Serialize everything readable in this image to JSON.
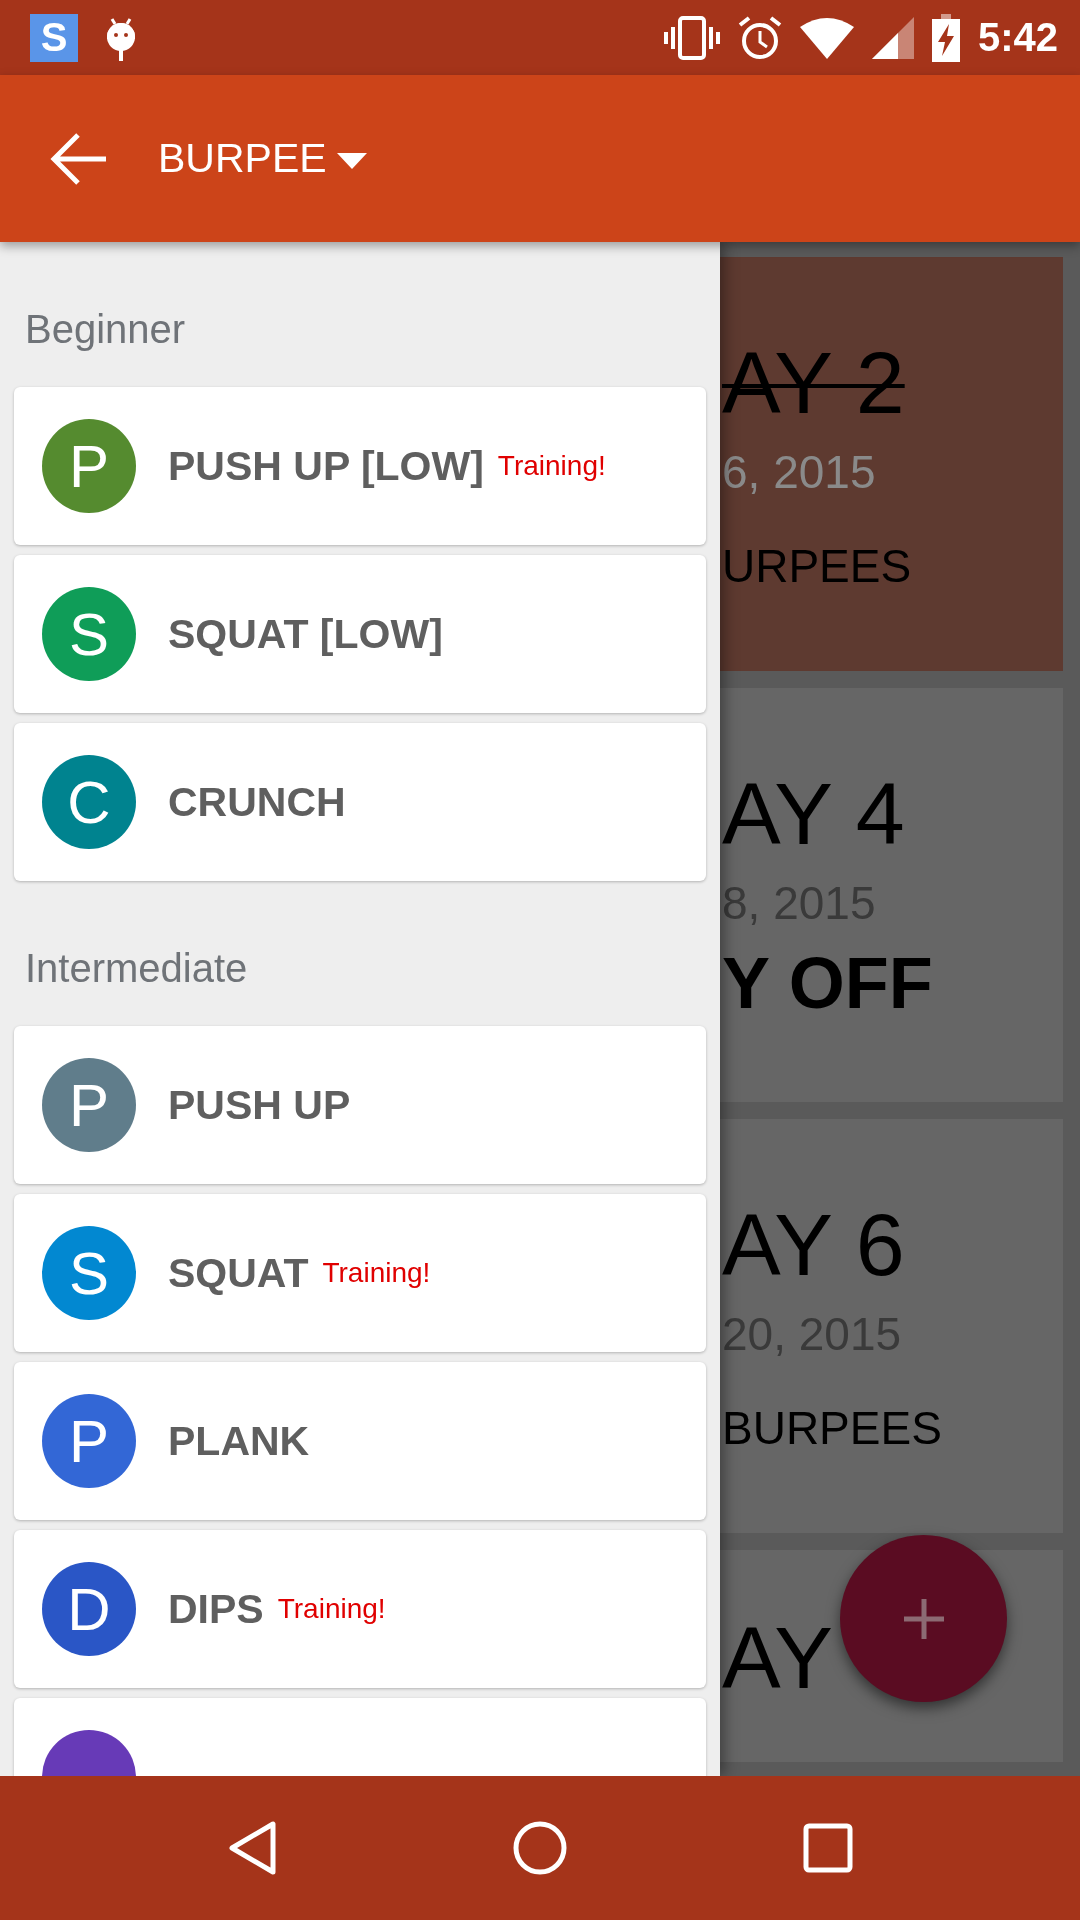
{
  "status_bar": {
    "app_icon_letter": "S",
    "time": "5:42"
  },
  "app_bar": {
    "title": "BURPEE"
  },
  "drawer": {
    "sections": [
      {
        "title": "Beginner",
        "items": [
          {
            "letter": "P",
            "name": "PUSH UP [LOW]",
            "badge": "Training!",
            "color": "#558b2f"
          },
          {
            "letter": "S",
            "name": "SQUAT [LOW]",
            "color": "#0f9d58"
          },
          {
            "letter": "C",
            "name": "CRUNCH",
            "color": "#00838f"
          }
        ]
      },
      {
        "title": "Intermediate",
        "items": [
          {
            "letter": "P",
            "name": "PUSH UP",
            "color": "#607d8b"
          },
          {
            "letter": "S",
            "name": "SQUAT",
            "badge": "Training!",
            "color": "#0288d1"
          },
          {
            "letter": "P",
            "name": "PLANK",
            "color": "#3367d6"
          },
          {
            "letter": "D",
            "name": "DIPS",
            "badge": "Training!",
            "color": "#2a56c6"
          },
          {
            "color": "#673ab7"
          }
        ]
      }
    ]
  },
  "day_cards": [
    {
      "kind": "workout",
      "day": "AY 2",
      "date": "6, 2015",
      "detail": "URPEES",
      "completed": true,
      "highlighted": true
    },
    {
      "kind": "off",
      "day": "AY 4",
      "date": "8, 2015",
      "detail": "Y OFF",
      "completed": false,
      "highlighted": false
    },
    {
      "kind": "workout",
      "day": "AY 6",
      "date": "20, 2015",
      "detail": "BURPEES",
      "completed": false,
      "highlighted": false
    },
    {
      "kind": "workout",
      "day": "AY",
      "completed": false,
      "highlighted": false
    }
  ]
}
